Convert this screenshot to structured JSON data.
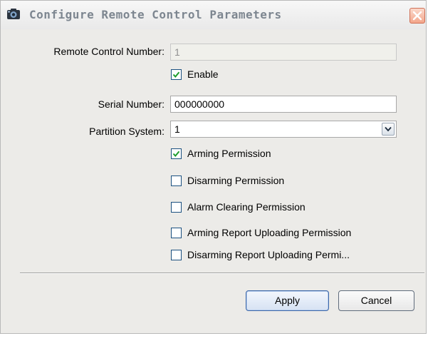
{
  "dialog": {
    "title": "Configure Remote Control Parameters",
    "title_icon": "camera-icon",
    "close_icon": "close-icon"
  },
  "form": {
    "remote_control_number": {
      "label": "Remote Control Number:",
      "value": "1",
      "disabled": true
    },
    "enable": {
      "label": "Enable",
      "checked": true
    },
    "serial_number": {
      "label": "Serial Number:",
      "value": "000000000"
    },
    "partition_system": {
      "label": "Partition System:",
      "selected": "1"
    },
    "permissions": [
      {
        "label": "Arming Permission",
        "checked": true
      },
      {
        "label": "Disarming Permission",
        "checked": false
      },
      {
        "label": "Alarm Clearing Permission",
        "checked": false
      },
      {
        "label": "Arming Report Uploading Permission",
        "checked": false
      },
      {
        "label": "Disarming Report Uploading Permi...",
        "checked": false
      }
    ]
  },
  "buttons": {
    "apply": "Apply",
    "cancel": "Cancel"
  },
  "colors": {
    "dialog_bg": "#ecebe8",
    "check_mark": "#1f9d2c",
    "title_text": "#7d8690"
  }
}
